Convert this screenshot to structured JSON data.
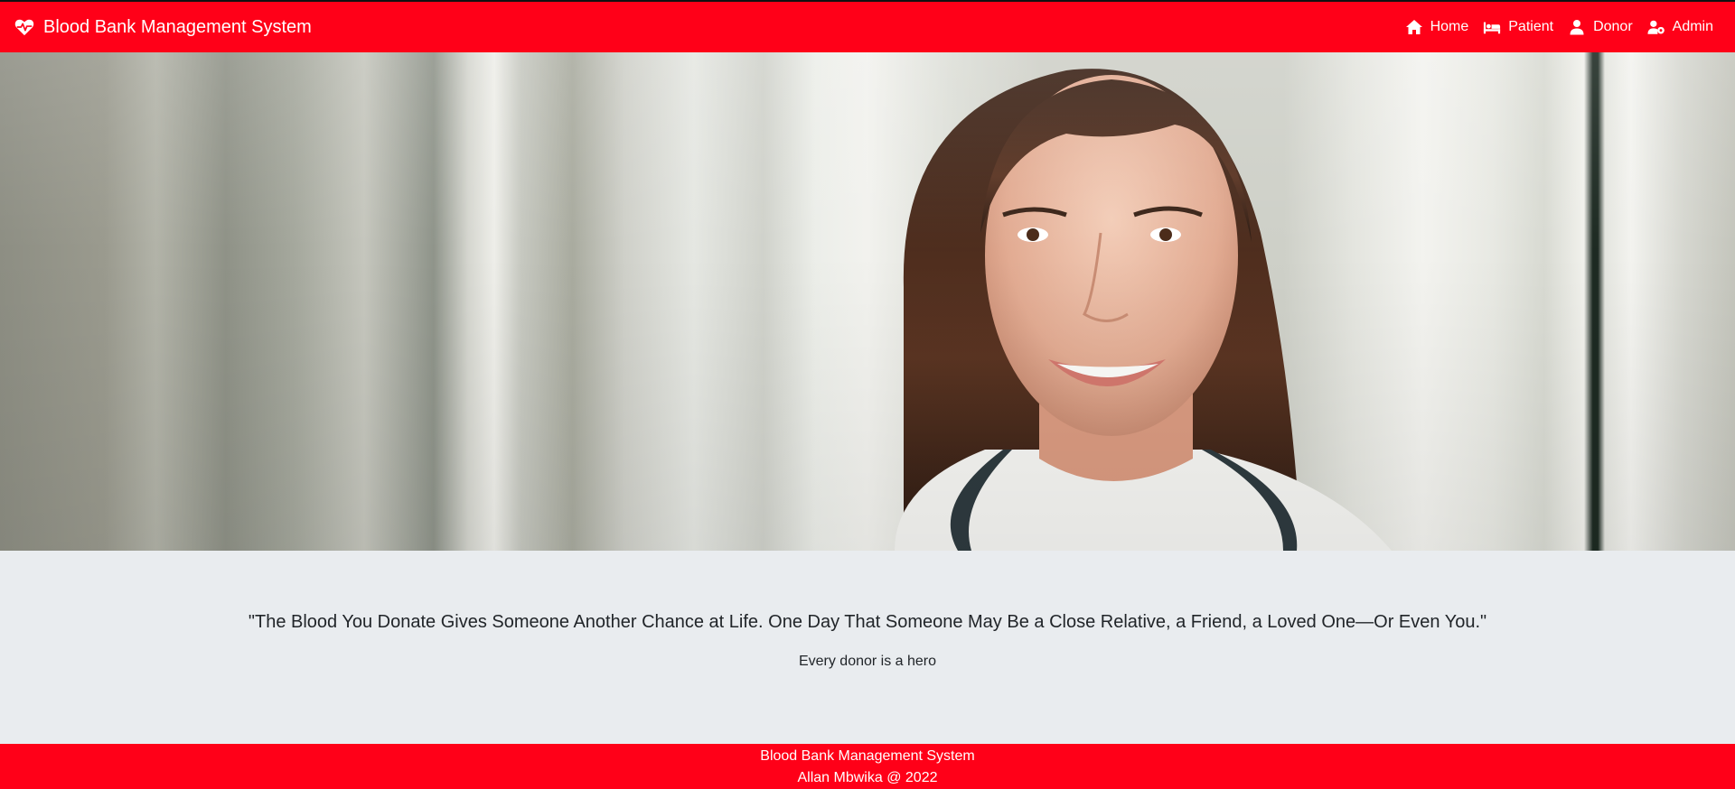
{
  "navbar": {
    "brand": "Blood Bank Management System",
    "brand_icon": "heart-pulse-icon",
    "links": [
      {
        "label": "Home",
        "icon": "home-icon"
      },
      {
        "label": "Patient",
        "icon": "bed-icon"
      },
      {
        "label": "Donor",
        "icon": "user-icon"
      },
      {
        "label": "Admin",
        "icon": "user-cog-icon"
      }
    ]
  },
  "hero": {
    "image": "smiling female doctor with stethoscope in hospital corridor"
  },
  "quote_section": {
    "quote": "\"The Blood You Donate Gives Someone Another Chance at Life. One Day That Someone May Be a Close Relative, a Friend, a Loved One—Or Even You.\"",
    "tagline": "Every donor is a hero"
  },
  "footer": {
    "line1": "Blood Bank Management System",
    "line2": "Allan Mbwika @ 2022"
  },
  "colors": {
    "brand_red": "#ff0018",
    "section_bg": "#e9ecef",
    "text": "#212529"
  }
}
